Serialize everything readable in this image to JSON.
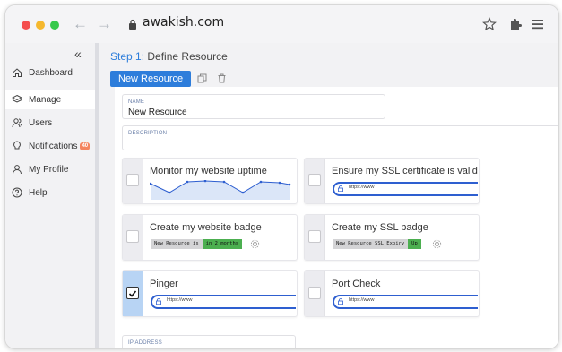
{
  "browser": {
    "url": "awakish.com",
    "dots": [
      "#f44e4e",
      "#f5b82e",
      "#36c94b"
    ]
  },
  "sidebar": {
    "items": [
      {
        "label": "Dashboard",
        "icon": "home-icon"
      },
      {
        "label": "Manage",
        "icon": "layers-icon",
        "active": true
      },
      {
        "label": "Users",
        "icon": "users-icon"
      },
      {
        "label": "Notifications",
        "icon": "bulb-icon",
        "badge": "40"
      },
      {
        "label": "My Profile",
        "icon": "user-icon"
      },
      {
        "label": "Help",
        "icon": "help-icon"
      }
    ]
  },
  "main": {
    "step_prefix": "Step 1:",
    "step_title": "Define Resource",
    "tab": "New Resource",
    "name_label": "NAME",
    "name_value": "New Resource",
    "description_label": "DESCRIPTION",
    "ip_label": "IP ADDRESS"
  },
  "cards": [
    {
      "title": "Monitor my website uptime",
      "kind": "sparkline",
      "checked": false
    },
    {
      "title": "Ensure my SSL certificate is valid",
      "kind": "url",
      "url": "https://www",
      "checked": false
    },
    {
      "title": "Create my website badge",
      "kind": "badge",
      "badge_left": "New Resource is",
      "badge_right": "in 2 months",
      "checked": false
    },
    {
      "title": "Create my SSL badge",
      "kind": "badge",
      "badge_left": "New Resource SSL Expiry",
      "badge_right": "Up",
      "checked": false
    },
    {
      "title": "Pinger",
      "kind": "url",
      "url": "https://www",
      "checked": true
    },
    {
      "title": "Port Check",
      "kind": "url",
      "url": "https://www",
      "checked": false
    }
  ],
  "colors": {
    "accent": "#2d7ddb",
    "badge_green": "#4caf50",
    "notification_badge": "#f4845f",
    "sparkline": "#2e5fd0"
  }
}
